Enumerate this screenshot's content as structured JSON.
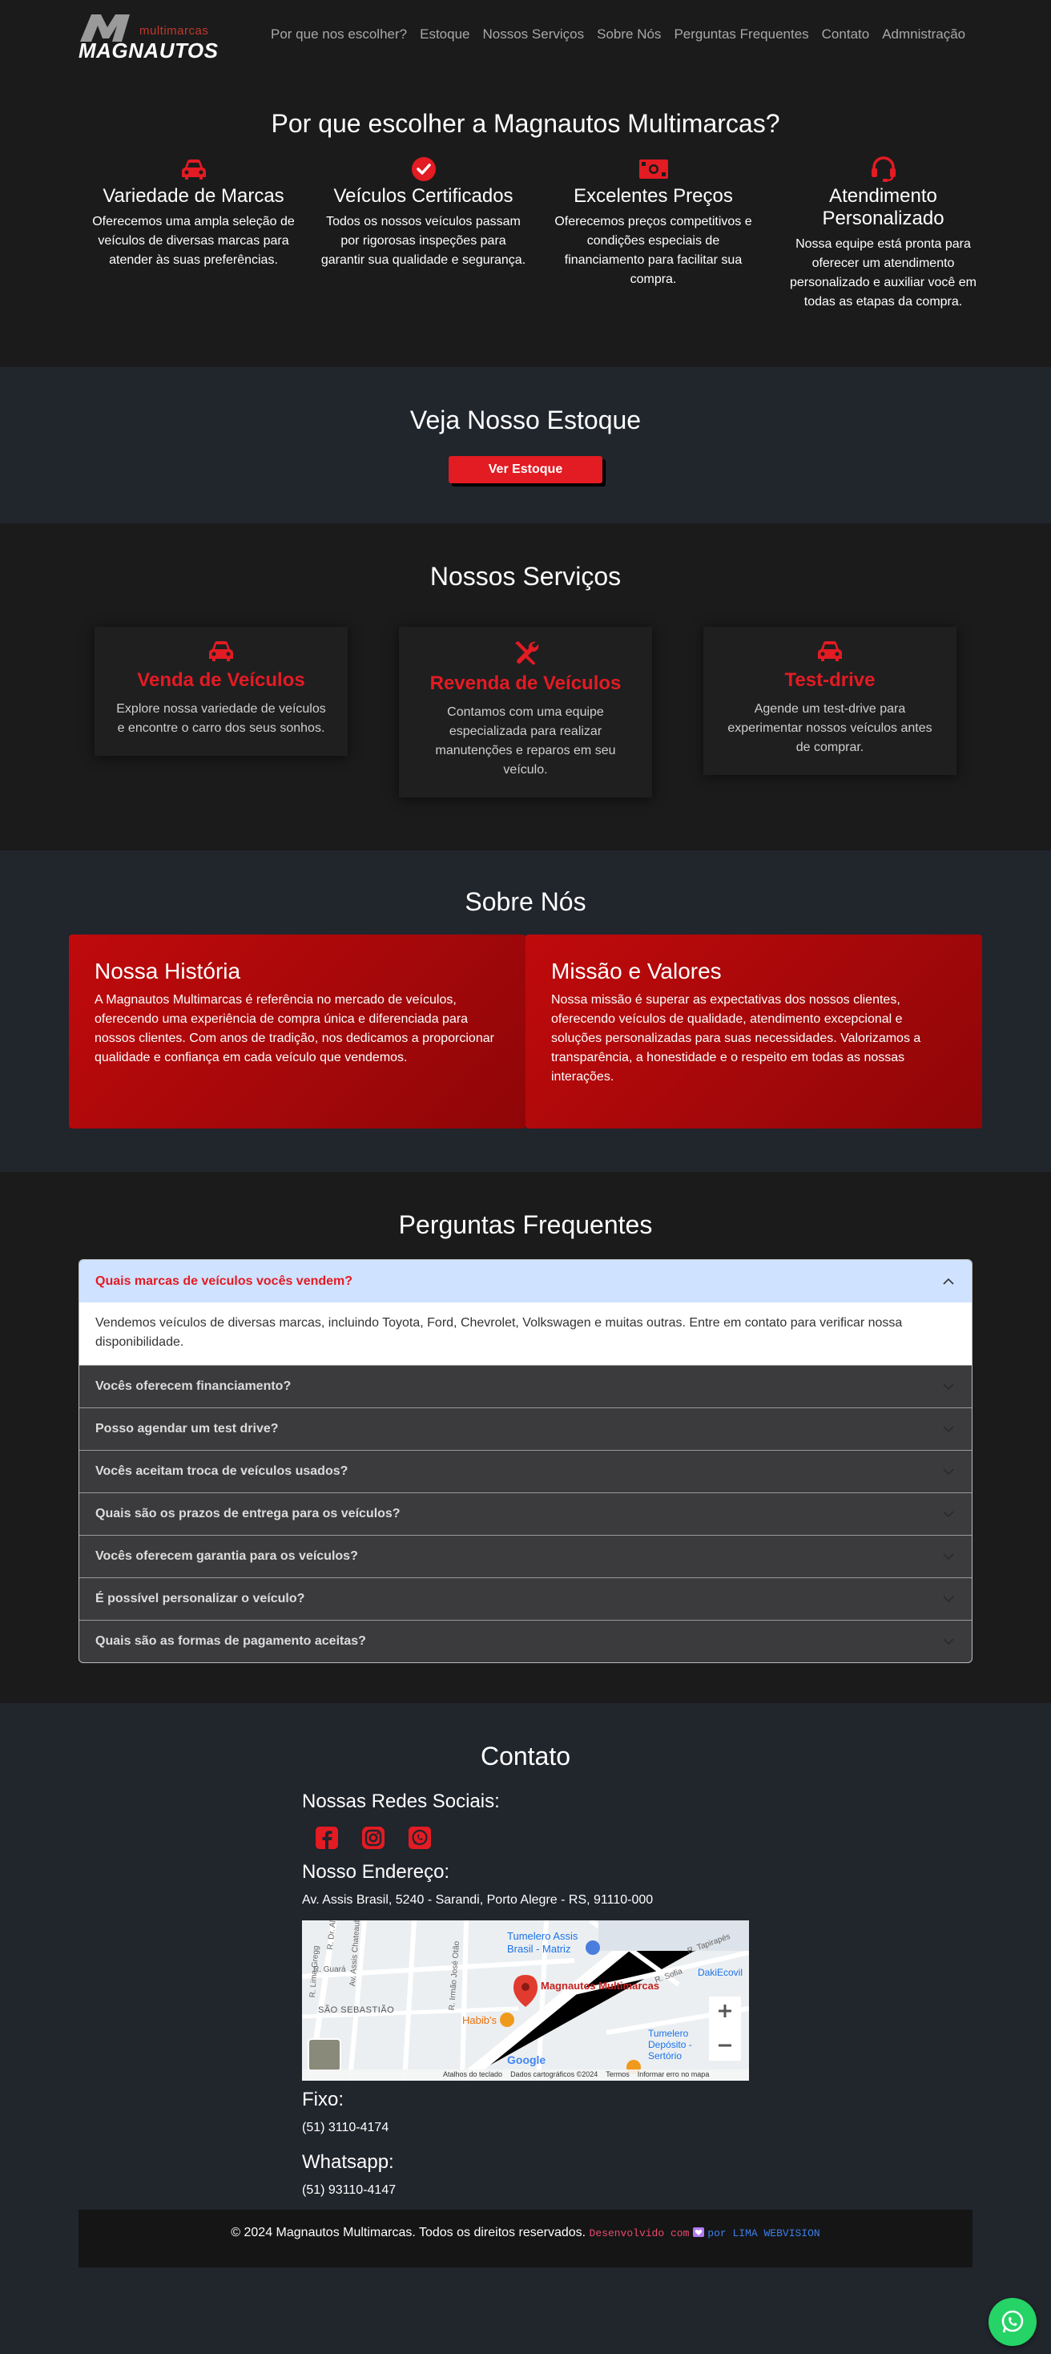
{
  "brand": {
    "small": "multimarcas",
    "big": "MAGNAUTOS"
  },
  "nav": [
    "Por que nos escolher?",
    "Estoque",
    "Nossos Serviços",
    "Sobre Nós",
    "Perguntas Frequentes",
    "Contato",
    "Admnistração"
  ],
  "why": {
    "title": "Por que escolher a Magnautos Multimarcas?",
    "items": [
      {
        "icon": "car-icon",
        "title": "Variedade de Marcas",
        "text": "Oferecemos uma ampla seleção de veículos de diversas marcas para atender às suas preferências."
      },
      {
        "icon": "check-circle-icon",
        "title": "Veículos Certificados",
        "text": "Todos os nossos veículos passam por rigorosas inspeções para garantir sua qualidade e segurança."
      },
      {
        "icon": "money-icon",
        "title": "Excelentes Preços",
        "text": "Oferecemos preços competitivos e condições especiais de financiamento para facilitar sua compra."
      },
      {
        "icon": "headset-icon",
        "title": "Atendimento Personalizado",
        "text": "Nossa equipe está pronta para oferecer um atendimento personalizado e auxiliar você em todas as etapas da compra."
      }
    ]
  },
  "stock": {
    "title": "Veja Nosso Estoque",
    "button": "Ver Estoque"
  },
  "services": {
    "title": "Nossos Serviços",
    "items": [
      {
        "icon": "car-icon",
        "title": "Venda de Veículos",
        "text": "Explore nossa variedade de veículos e encontre o carro dos seus sonhos."
      },
      {
        "icon": "tools-icon",
        "title": "Revenda de Veículos",
        "text": "Contamos com uma equipe especializada para realizar manutenções e reparos em seu veículo."
      },
      {
        "icon": "car-icon",
        "title": "Test-drive",
        "text": "Agende um test-drive para experimentar nossos veículos antes de comprar."
      }
    ]
  },
  "about": {
    "title": "Sobre Nós",
    "cards": [
      {
        "title": "Nossa História",
        "text": "A Magnautos Multimarcas é referência no mercado de veículos, oferecendo uma experiência de compra única e diferenciada para nossos clientes. Com anos de tradição, nos dedicamos a proporcionar qualidade e confiança em cada veículo que vendemos."
      },
      {
        "title": "Missão e Valores",
        "text": "Nossa missão é superar as expectativas dos nossos clientes, oferecendo veículos de qualidade, atendimento excepcional e soluções personalizadas para suas necessidades. Valorizamos a transparência, a honestidade e o respeito em todas as nossas interações."
      }
    ]
  },
  "faq": {
    "title": "Perguntas Frequentes",
    "items": [
      {
        "q": "Quais marcas de veículos vocês vendem?",
        "a": "Vendemos veículos de diversas marcas, incluindo Toyota, Ford, Chevrolet, Volkswagen e muitas outras. Entre em contato para verificar nossa disponibilidade.",
        "open": true
      },
      {
        "q": "Vocês oferecem financiamento?"
      },
      {
        "q": "Posso agendar um test drive?"
      },
      {
        "q": "Vocês aceitam troca de veículos usados?"
      },
      {
        "q": "Quais são os prazos de entrega para os veículos?"
      },
      {
        "q": "Vocês oferecem garantia para os veículos?"
      },
      {
        "q": "É possível personalizar o veículo?"
      },
      {
        "q": "Quais são as formas de pagamento aceitas?"
      }
    ]
  },
  "contact": {
    "title": "Contato",
    "social_heading": "Nossas Redes Sociais:",
    "social_icons": [
      "facebook-icon",
      "instagram-icon",
      "whatsapp-icon"
    ],
    "address_heading": "Nosso Endereço:",
    "address": "Av. Assis Brasil, 5240 - Sarandi, Porto Alegre - RS, 91110-000",
    "map": {
      "marker_label": "Magnautos Multimarcas",
      "poi_1": "Tumelero Assis Brasil - Matriz",
      "poi_2": "DakiEcovil",
      "poi_3": "Habib's",
      "poi_4": "Tumelero Depósito - Sertório",
      "district": "SÃO SEBASTIÃO",
      "streets": [
        "R. Guará",
        "R. Dr. Alberto Albertini",
        "R. Irmão José Otão",
        "R. Tapirapés",
        "R. Sofia",
        "Av. Assis Chateaubriand",
        "R. Lima Gregg"
      ],
      "footer": [
        "Atalhos do teclado",
        "Dados cartográficos ©2024",
        "Termos",
        "Informar erro no mapa"
      ],
      "google": "Google"
    },
    "fixed_heading": "Fixo:",
    "fixed_phone": "(51) 3110-4174",
    "whatsapp_heading": "Whatsapp:",
    "whatsapp_phone": "(51) 93110-4147"
  },
  "footer": {
    "copyright": "© 2024 Magnautos Multimarcas. Todos os direitos reservados.",
    "dev_prefix": "Desenvolvido com",
    "dev_by": "por LIMA WEBVISION"
  },
  "colors": {
    "accent": "#e31b23",
    "bg_dark": "#1b1b1c",
    "bg_slate": "#21252c",
    "whatsapp": "#25d366"
  }
}
